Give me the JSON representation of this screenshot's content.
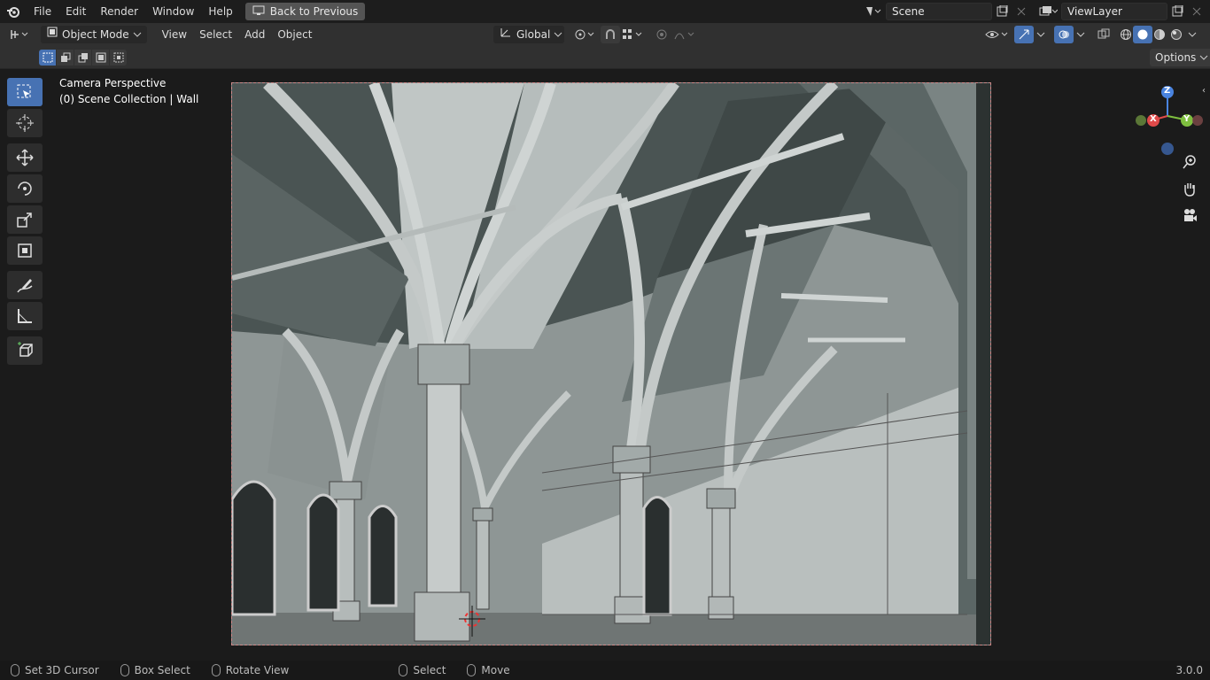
{
  "menus": [
    "File",
    "Edit",
    "Render",
    "Window",
    "Help"
  ],
  "back_button": "Back to Previous",
  "scene": "Scene",
  "view_layer": "ViewLayer",
  "mode": "Object Mode",
  "header_menus": [
    "View",
    "Select",
    "Add",
    "Object"
  ],
  "orientation": "Global",
  "options_label": "Options",
  "viewport_text": {
    "line1": "Camera Perspective",
    "line2": "(0) Scene Collection | Wall"
  },
  "gizmo": {
    "z": "Z",
    "x": "X",
    "y": "Y"
  },
  "status": [
    {
      "label": "Set 3D Cursor"
    },
    {
      "label": "Box Select"
    },
    {
      "label": "Rotate View"
    },
    {
      "label": "Select"
    },
    {
      "label": "Move"
    }
  ],
  "version": "3.0.0"
}
